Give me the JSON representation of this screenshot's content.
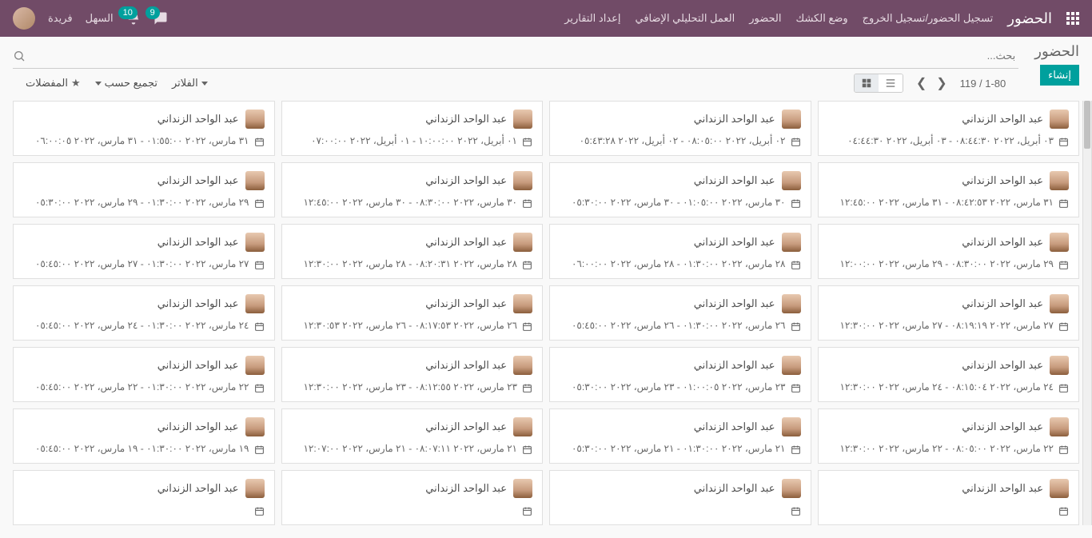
{
  "topnav": {
    "brand": "الحضور",
    "menu": [
      "تسجيل الحضور/تسجيل الخروج",
      "وضع الكشك",
      "الحضور",
      "العمل التحليلي الإضافي",
      "إعداد التقارير"
    ],
    "company": "السهل",
    "user": "فريدة",
    "messages_badge": "9",
    "activities_badge": "10"
  },
  "header": {
    "title": "الحضور",
    "create": "إنشاء"
  },
  "search": {
    "placeholder": "بحث..."
  },
  "filters": {
    "filters": "الفلاتر",
    "groupby": "تجميع حسب",
    "favorites": "المفضلات"
  },
  "pager": {
    "text": "1-80 / 119"
  },
  "employee_name": "عبد الواحد الزنداني",
  "cards": [
    {
      "range": "٠٣ أبريل، ٢٠٢٢ ٠٨:٤٤:٣٠ - ٠٣ أبريل، ٢٠٢٢ ٠٤:٤٤:٣٠"
    },
    {
      "range": "٠٢ أبريل، ٢٠٢٢ ٠٨:٠٥:٠٠ - ٠٢ أبريل، ٢٠٢٢ ٠٥:٤٣:٢٨"
    },
    {
      "range": "٠١ أبريل، ٢٠٢٢ ١٠:٠٠:٠٠ - ٠١ أبريل، ٢٠٢٢ ٠٧:٠٠:٠٠"
    },
    {
      "range": "٣١ مارس، ٢٠٢٢ ٠١:٥٥:٠٠ - ٣١ مارس، ٢٠٢٢ ٠٦:٠٠:٠٥"
    },
    {
      "range": "٣١ مارس، ٢٠٢٢ ٠٨:٤٢:٥٣ - ٣١ مارس، ٢٠٢٢ ١٢:٤٥:٠٠"
    },
    {
      "range": "٣٠ مارس، ٢٠٢٢ ٠١:٠٥:٠٠ - ٣٠ مارس، ٢٠٢٢ ٠٥:٣٠:٠٠"
    },
    {
      "range": "٣٠ مارس، ٢٠٢٢ ٠٨:٣٠:٠٠ - ٣٠ مارس، ٢٠٢٢ ١٢:٤٥:٠٠"
    },
    {
      "range": "٢٩ مارس، ٢٠٢٢ ٠١:٣٠:٠٠ - ٢٩ مارس، ٢٠٢٢ ٠٥:٣٠:٠٠"
    },
    {
      "range": "٢٩ مارس، ٢٠٢٢ ٠٨:٣٠:٠٠ - ٢٩ مارس، ٢٠٢٢ ١٢:٠٠:٠٠"
    },
    {
      "range": "٢٨ مارس، ٢٠٢٢ ٠١:٣٠:٠٠ - ٢٨ مارس، ٢٠٢٢ ٠٦:٠٠:٠٠"
    },
    {
      "range": "٢٨ مارس، ٢٠٢٢ ٠٨:٢٠:٣١ - ٢٨ مارس، ٢٠٢٢ ١٢:٣٠:٠٠"
    },
    {
      "range": "٢٧ مارس، ٢٠٢٢ ٠١:٣٠:٠٠ - ٢٧ مارس، ٢٠٢٢ ٠٥:٤٥:٠٠"
    },
    {
      "range": "٢٧ مارس، ٢٠٢٢ ٠٨:١٩:١٩ - ٢٧ مارس، ٢٠٢٢ ١٢:٣٠:٠٠"
    },
    {
      "range": "٢٦ مارس، ٢٠٢٢ ٠١:٣٠:٠٠ - ٢٦ مارس، ٢٠٢٢ ٠٥:٤٥:٠٠"
    },
    {
      "range": "٢٦ مارس، ٢٠٢٢ ٠٨:١٧:٥٣ - ٢٦ مارس، ٢٠٢٢ ١٢:٣٠:٥٣"
    },
    {
      "range": "٢٤ مارس، ٢٠٢٢ ٠١:٣٠:٠٠ - ٢٤ مارس، ٢٠٢٢ ٠٥:٤٥:٠٠"
    },
    {
      "range": "٢٤ مارس، ٢٠٢٢ ٠٨:١٥:٠٤ - ٢٤ مارس، ٢٠٢٢ ١٢:٣٠:٠٠"
    },
    {
      "range": "٢٣ مارس، ٢٠٢٢ ٠١:٠٠:٠٥ - ٢٣ مارس، ٢٠٢٢ ٠٥:٣٠:٠٠"
    },
    {
      "range": "٢٣ مارس، ٢٠٢٢ ٠٨:١٢:٥٥ - ٢٣ مارس، ٢٠٢٢ ١٢:٣٠:٠٠"
    },
    {
      "range": "٢٢ مارس، ٢٠٢٢ ٠١:٣٠:٠٠ - ٢٢ مارس، ٢٠٢٢ ٠٥:٤٥:٠٠"
    },
    {
      "range": "٢٢ مارس، ٢٠٢٢ ٠٨:٠٥:٠٠ - ٢٢ مارس، ٢٠٢٢ ١٢:٣٠:٠٠"
    },
    {
      "range": "٢١ مارس، ٢٠٢٢ ٠١:٣٠:٠٠ - ٢١ مارس، ٢٠٢٢ ٠٥:٣٠:٠٠"
    },
    {
      "range": "٢١ مارس، ٢٠٢٢ ٠٨:٠٧:١١ - ٢١ مارس، ٢٠٢٢ ١٢:٠٧:٠٠"
    },
    {
      "range": "١٩ مارس، ٢٠٢٢ ٠١:٣٠:٠٠ - ١٩ مارس، ٢٠٢٢ ٠٥:٤٥:٠٠"
    },
    {
      "range": ""
    },
    {
      "range": ""
    },
    {
      "range": ""
    },
    {
      "range": ""
    }
  ]
}
